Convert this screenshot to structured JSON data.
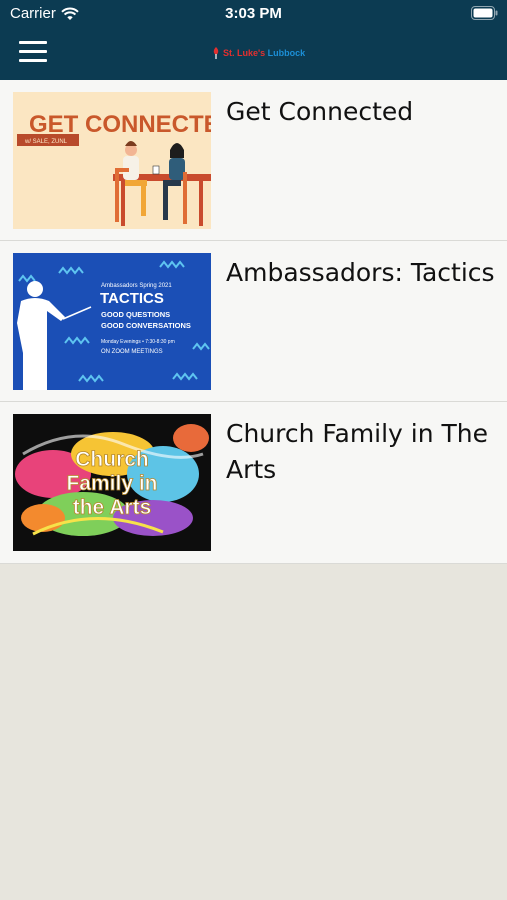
{
  "status_bar": {
    "carrier": "Carrier",
    "time": "3:03 PM",
    "wifi_icon": "wifi-icon",
    "battery_icon": "battery-icon"
  },
  "nav": {
    "menu_icon": "hamburger-menu-icon",
    "logo_brand_red": "St. Luke's",
    "logo_brand_blue": "Lubbock",
    "background": "#0c3b52"
  },
  "items": [
    {
      "title": "Get Connected",
      "thumb_text": "GET CONNECTED",
      "thumb_subtext": "w/ SALE, ZUNL"
    },
    {
      "title": "Ambassadors: Tactics",
      "thumb_line1": "Ambassadors Spring 2021",
      "thumb_line2": "TACTICS",
      "thumb_line3": "GOOD QUESTIONS",
      "thumb_line4": "GOOD CONVERSATIONS",
      "thumb_line5": "Monday Evenings • 7:30-8:30 pm",
      "thumb_line6": "ON ZOOM MEETINGS"
    },
    {
      "title": "Church Family in The Arts",
      "thumb_line1": "Church",
      "thumb_line2": "Family in",
      "thumb_line3": "the Arts"
    }
  ]
}
